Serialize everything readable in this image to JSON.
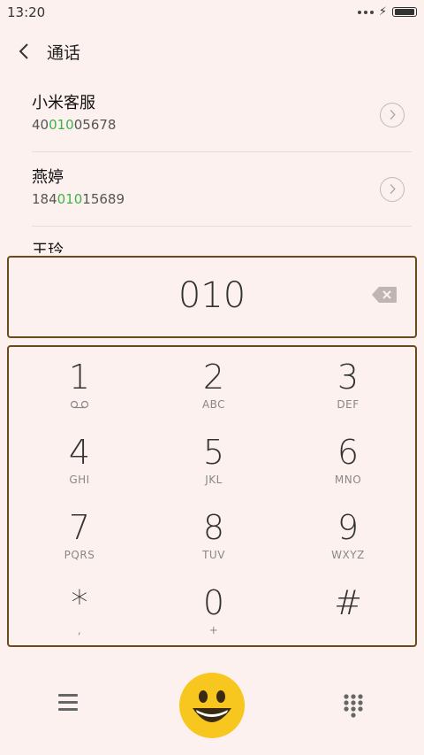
{
  "status_bar": {
    "time": "13:20"
  },
  "header": {
    "title": "通话"
  },
  "contacts": [
    {
      "name": "小米客服",
      "num_pre": "40",
      "num_match": "010",
      "num_post": "05678"
    },
    {
      "name": "燕婷",
      "num_pre": "184",
      "num_match": "010",
      "num_post": "15689"
    },
    {
      "name": "王玲"
    }
  ],
  "dial": {
    "input": "010"
  },
  "keys": [
    {
      "digit": "1",
      "letters": ""
    },
    {
      "digit": "2",
      "letters": "ABC"
    },
    {
      "digit": "3",
      "letters": "DEF"
    },
    {
      "digit": "4",
      "letters": "GHI"
    },
    {
      "digit": "5",
      "letters": "JKL"
    },
    {
      "digit": "6",
      "letters": "MNO"
    },
    {
      "digit": "7",
      "letters": "PQRS"
    },
    {
      "digit": "8",
      "letters": "TUV"
    },
    {
      "digit": "9",
      "letters": "WXYZ"
    },
    {
      "digit": "*",
      "letters": ","
    },
    {
      "digit": "0",
      "letters": "+"
    },
    {
      "digit": "#",
      "letters": ""
    }
  ],
  "colors": {
    "accent": "#3fb24a",
    "background": "#fcf1ee",
    "border": "#6b4a1e",
    "smile": "#f7c71f"
  },
  "icons": {
    "key1": "voicemail-icon",
    "back": "chevron-left-icon",
    "delete": "backspace-icon",
    "menu": "menu-icon",
    "call": "smiley-call-icon",
    "keypad": "dialpad-icon"
  }
}
